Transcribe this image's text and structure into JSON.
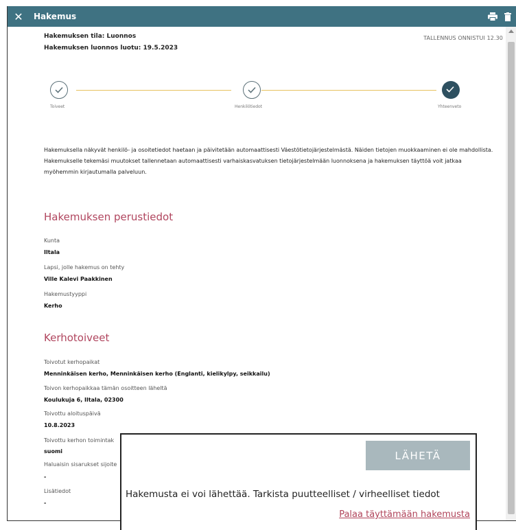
{
  "window": {
    "title": "Hakemus",
    "close_icon": "close-icon",
    "print_icon": "print-icon",
    "delete_icon": "trash-icon"
  },
  "header": {
    "status_line": "Hakemuksen tila: Luonnos",
    "created_line": "Hakemuksen luonnos luotu: 19.5.2023",
    "saved_notice": "TALLENNUS ONNISTUI 12.30"
  },
  "stepper": {
    "steps": [
      {
        "label": "Toiveet",
        "state": "done"
      },
      {
        "label": "Henkilötiedot",
        "state": "done"
      },
      {
        "label": "Yhteenveto",
        "state": "current"
      }
    ],
    "line_color": "#e6c15f"
  },
  "intro": "Hakemuksella näkyvät henkilö- ja osoitetiedot haetaan ja päivitetään automaattisesti Väestötietojärjestelmästä. Näiden tietojen muokkaaminen ei ole mahdollista. Hakemukselle tekemäsi muutokset tallennetaan automaattisesti varhaiskasvatuksen tietojärjestelmään luonnoksena ja hakemuksen täyttöä voit jatkaa myöhemmin kirjautumalla palveluun.",
  "basic": {
    "title": "Hakemuksen perustiedot",
    "fields": [
      {
        "label": "Kunta",
        "value": "Iltala"
      },
      {
        "label": "Lapsi, jolle hakemus on tehty",
        "value": "Ville Kalevi Paakkinen"
      },
      {
        "label": "Hakemustyyppi",
        "value": "Kerho"
      }
    ]
  },
  "club": {
    "title": "Kerhotoiveet",
    "fields": [
      {
        "label": "Toivotut kerhopaikat",
        "value": "Menninkäisen kerho, Menninkäisen kerho (Englanti, kielikylpy, seikkailu)"
      },
      {
        "label": "Toivon kerhopaikkaa tämän osoitteen läheltä",
        "value": "Koulukuja 6, Iltala, 02300"
      },
      {
        "label": "Toivottu aloituspäivä",
        "value": "10.8.2023"
      },
      {
        "label": "Toivottu kerhon toimintak",
        "value": "suomi"
      },
      {
        "label": "Haluaisin sisarukset sijoite",
        "value": "-"
      },
      {
        "label": "Lisätiedot",
        "value": "-"
      }
    ]
  },
  "popup": {
    "send_label": "LÄHETÄ",
    "message": "Hakemusta ei voi lähettää. Tarkista puutteelliset / virheelliset tiedot",
    "link": "Palaa täyttämään hakemusta"
  },
  "colors": {
    "titlebar": "#3f7282",
    "section_title": "#b0455e",
    "send_button_disabled": "#a9b8bd",
    "link": "#b0445a"
  }
}
